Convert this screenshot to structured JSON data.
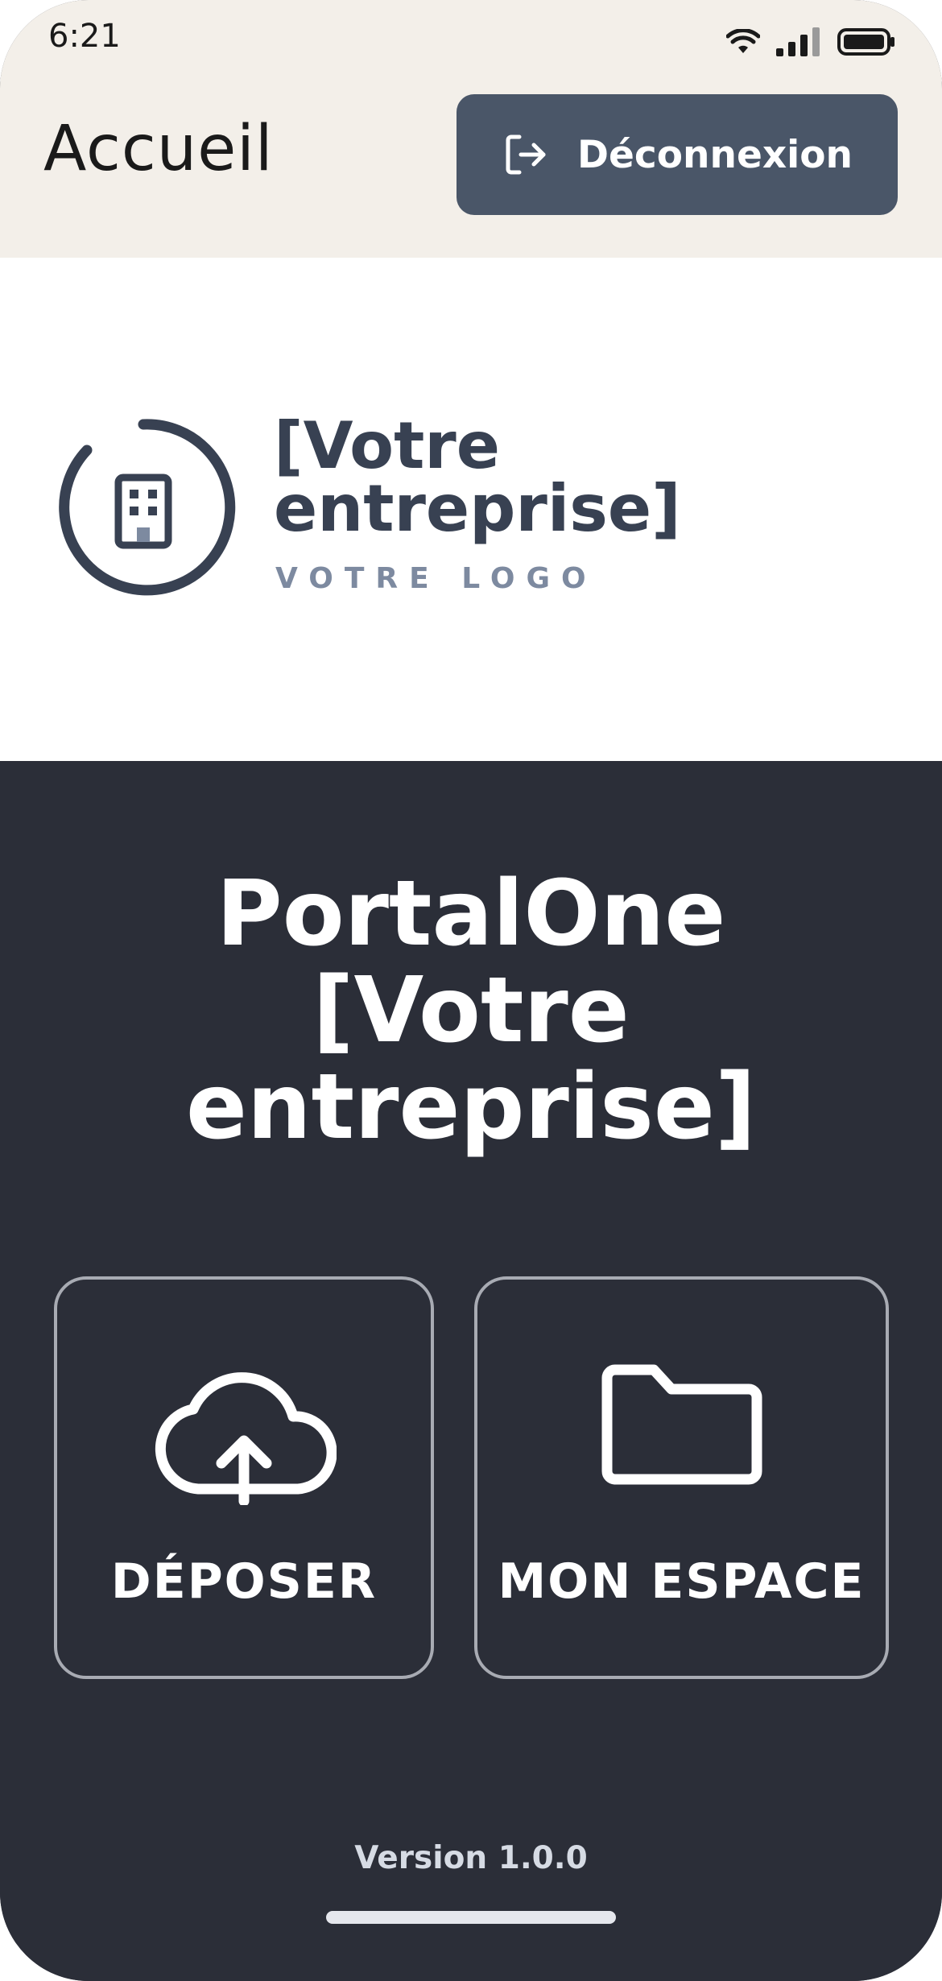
{
  "status_bar": {
    "time": "6:21",
    "icons": [
      "wifi-icon",
      "signal-icon",
      "battery-icon"
    ]
  },
  "app_bar": {
    "title": "Accueil",
    "logout_label": "Déconnexion",
    "logout_icon": "logout-icon"
  },
  "logo": {
    "icon": "building-icon",
    "name": "[Votre\nentreprise]",
    "tagline": "VOTRE LOGO"
  },
  "main": {
    "title": "PortalOne\n[Votre\nentreprise]",
    "tiles": [
      {
        "label": "DÉPOSER",
        "icon": "cloud-upload-icon"
      },
      {
        "label": "MON ESPACE",
        "icon": "folder-icon"
      }
    ],
    "version": "Version 1.0.0"
  },
  "colors": {
    "header_bg": "#f3efe9",
    "button_bg": "#4a5668",
    "logo_dark": "#384152",
    "logo_muted": "#7d8aa0",
    "main_bg": "#2b2e38",
    "tile_border": "#a8abb3"
  }
}
